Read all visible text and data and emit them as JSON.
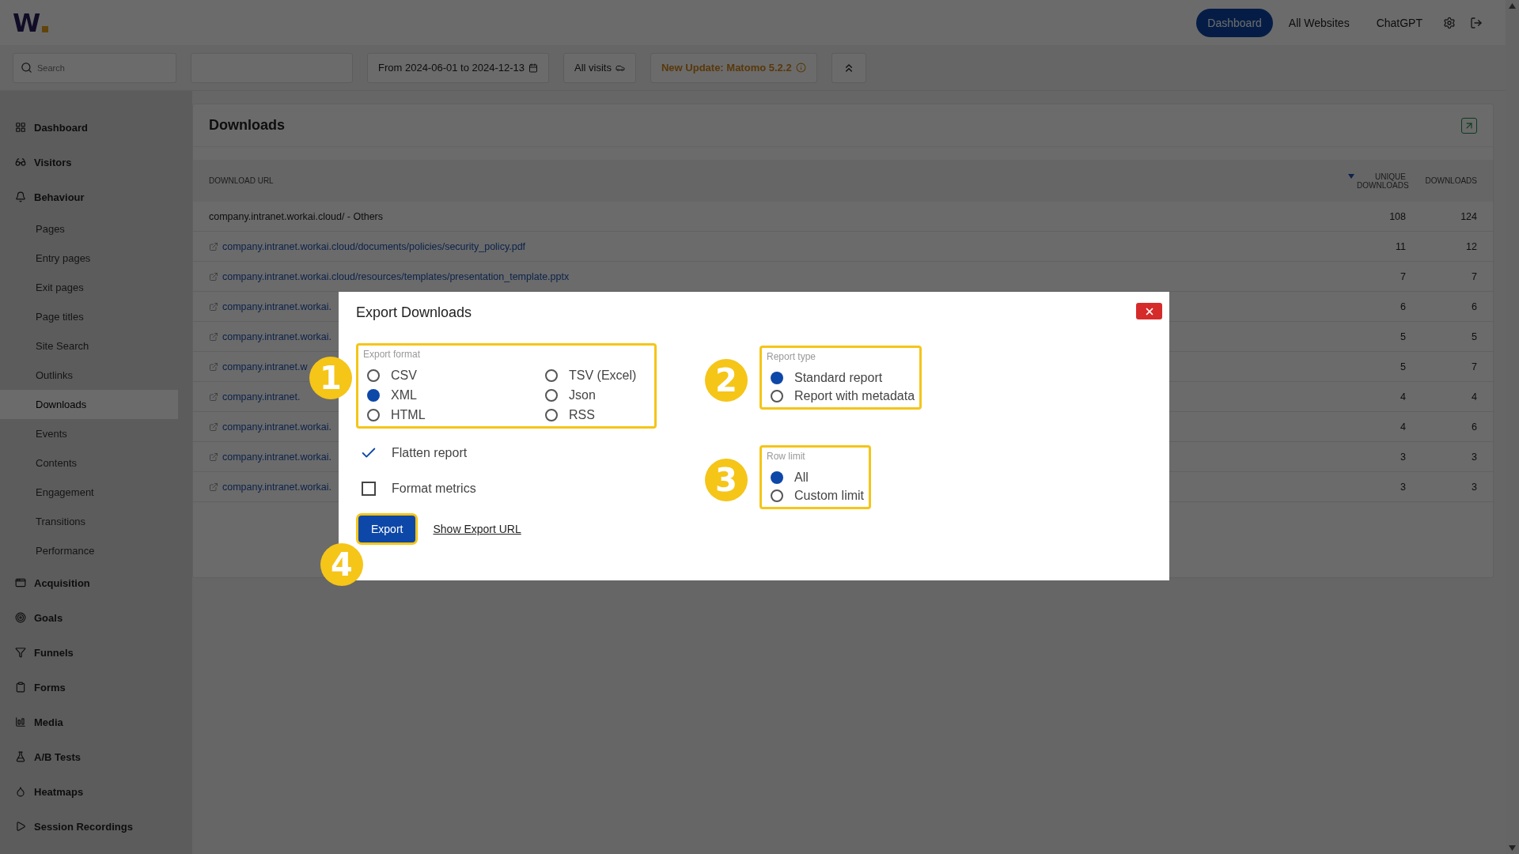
{
  "header": {
    "logo": "W",
    "nav": [
      {
        "label": "Dashboard",
        "selected": true
      },
      {
        "label": "All Websites",
        "selected": false
      },
      {
        "label": "ChatGPT",
        "selected": false
      }
    ]
  },
  "toolbar": {
    "search": {
      "placeholder": "Search"
    },
    "date_range": "From 2024-06-01 to 2024-12-13",
    "segment": "All visits",
    "update": "New Update: Matomo 5.2.2"
  },
  "sidebar": {
    "items": [
      {
        "label": "Dashboard",
        "selected": false
      },
      {
        "label": "Visitors",
        "selected": false
      },
      {
        "label": "Behaviour",
        "selected": false,
        "children": [
          {
            "label": "Pages",
            "selected": false
          },
          {
            "label": "Entry pages",
            "selected": false
          },
          {
            "label": "Exit pages",
            "selected": false
          },
          {
            "label": "Page titles",
            "selected": false
          },
          {
            "label": "Site Search",
            "selected": false
          },
          {
            "label": "Outlinks",
            "selected": false
          },
          {
            "label": "Downloads",
            "selected": true
          },
          {
            "label": "Events",
            "selected": false
          },
          {
            "label": "Contents",
            "selected": false
          },
          {
            "label": "Engagement",
            "selected": false
          },
          {
            "label": "Transitions",
            "selected": false
          },
          {
            "label": "Performance",
            "selected": false
          }
        ]
      },
      {
        "label": "Acquisition",
        "selected": false
      },
      {
        "label": "Goals",
        "selected": false
      },
      {
        "label": "Funnels",
        "selected": false
      },
      {
        "label": "Forms",
        "selected": false
      },
      {
        "label": "Media",
        "selected": false
      },
      {
        "label": "A/B Tests",
        "selected": false
      },
      {
        "label": "Heatmaps",
        "selected": false
      },
      {
        "label": "Session Recordings",
        "selected": false
      }
    ]
  },
  "report": {
    "title": "Downloads",
    "columns": [
      {
        "label": "DOWNLOAD URL",
        "sorted": false
      },
      {
        "label": "UNIQUE DOWNLOADS",
        "sorted": true
      },
      {
        "label": "DOWNLOADS",
        "sorted": false
      }
    ],
    "rows": [
      {
        "kind": "group",
        "url": "company.intranet.workai.cloud/ - Others",
        "unique": "108",
        "downloads": "124"
      },
      {
        "kind": "link",
        "url": "company.intranet.workai.cloud/documents/policies/security_policy.pdf",
        "unique": "11",
        "downloads": "12"
      },
      {
        "kind": "link",
        "url": "company.intranet.workai.cloud/resources/templates/presentation_template.pptx",
        "unique": "7",
        "downloads": "7"
      },
      {
        "kind": "link",
        "url": "company.intranet.workai.",
        "unique": "6",
        "downloads": "6"
      },
      {
        "kind": "link",
        "url": "company.intranet.workai.",
        "unique": "5",
        "downloads": "5"
      },
      {
        "kind": "link",
        "url": "company.intranet.w",
        "unique": "5",
        "downloads": "7"
      },
      {
        "kind": "link",
        "url": "company.intranet.",
        "unique": "4",
        "downloads": "4"
      },
      {
        "kind": "link",
        "url": "company.intranet.workai.",
        "unique": "4",
        "downloads": "6"
      },
      {
        "kind": "link",
        "url": "company.intranet.workai.",
        "unique": "3",
        "downloads": "3"
      },
      {
        "kind": "link",
        "url": "company.intranet.workai.",
        "unique": "3",
        "downloads": "3"
      }
    ]
  },
  "dialog": {
    "title": "Export Downloads",
    "export_format": {
      "legend": "Export format",
      "options": [
        {
          "label": "CSV",
          "selected": false
        },
        {
          "label": "TSV (Excel)",
          "selected": false
        },
        {
          "label": "XML",
          "selected": true
        },
        {
          "label": "Json",
          "selected": false
        },
        {
          "label": "HTML",
          "selected": false
        },
        {
          "label": "RSS",
          "selected": false
        }
      ]
    },
    "options": [
      {
        "label": "Flatten report",
        "checked": true
      },
      {
        "label": "Format metrics",
        "checked": false
      }
    ],
    "report_type": {
      "legend": "Report type",
      "options": [
        {
          "label": "Standard report",
          "selected": true
        },
        {
          "label": "Report with metadata",
          "selected": false
        }
      ]
    },
    "row_limit": {
      "legend": "Row limit",
      "options": [
        {
          "label": "All",
          "selected": true
        },
        {
          "label": "Custom limit",
          "selected": false
        }
      ]
    },
    "export_button": "Export",
    "export_url_link": "Show Export URL",
    "callouts": [
      "1",
      "2",
      "3",
      "4"
    ]
  }
}
